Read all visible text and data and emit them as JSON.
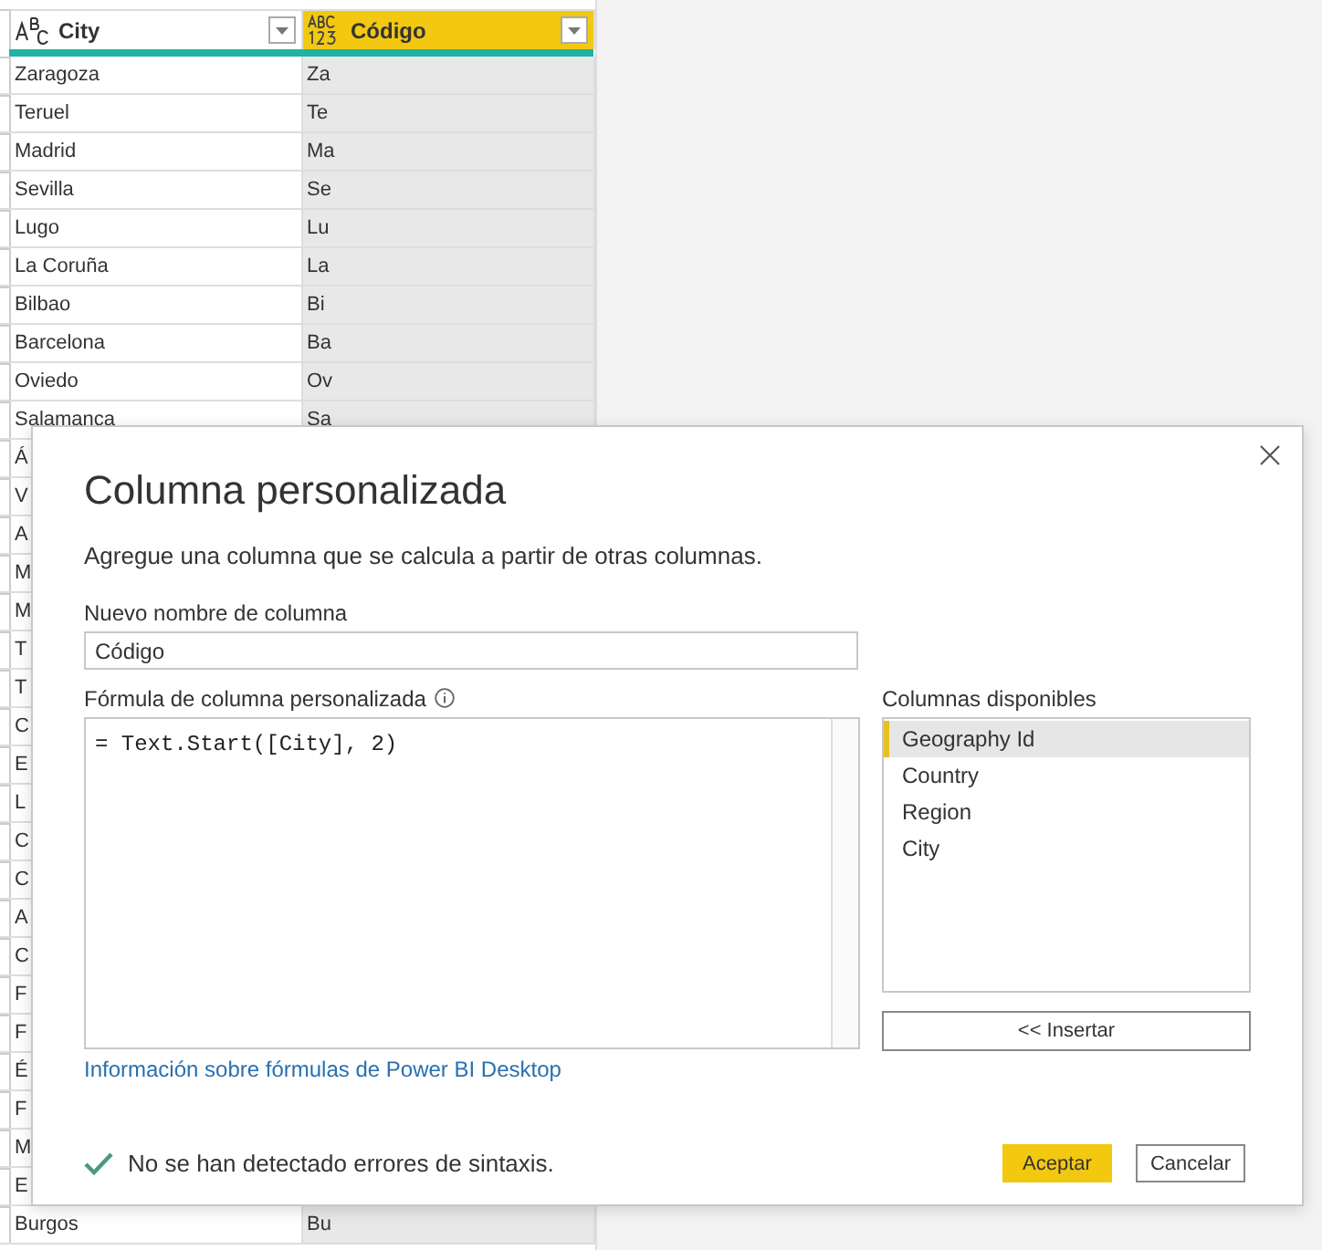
{
  "table": {
    "columns": [
      {
        "label": "City",
        "kind": "text",
        "selected": false
      },
      {
        "label": "Código",
        "kind": "any",
        "selected": true
      }
    ],
    "rows": [
      {
        "city": "Zaragoza",
        "code": "Za"
      },
      {
        "city": "Teruel",
        "code": "Te"
      },
      {
        "city": "Madrid",
        "code": "Ma"
      },
      {
        "city": "Sevilla",
        "code": "Se"
      },
      {
        "city": "Lugo",
        "code": "Lu"
      },
      {
        "city": "La Coruña",
        "code": "La"
      },
      {
        "city": "Bilbao",
        "code": "Bi"
      },
      {
        "city": "Barcelona",
        "code": "Ba"
      },
      {
        "city": "Oviedo",
        "code": "Ov"
      },
      {
        "city": "Salamanca",
        "code": "Sa"
      },
      {
        "city": "Á"
      },
      {
        "city": "V"
      },
      {
        "city": "A"
      },
      {
        "city": "M"
      },
      {
        "city": "M"
      },
      {
        "city": "T"
      },
      {
        "city": "T"
      },
      {
        "city": "C"
      },
      {
        "city": "E"
      },
      {
        "city": "L"
      },
      {
        "city": "C"
      },
      {
        "city": "C"
      },
      {
        "city": "A"
      },
      {
        "city": "C"
      },
      {
        "city": "F"
      },
      {
        "city": "F"
      },
      {
        "city": "É"
      },
      {
        "city": "F"
      },
      {
        "city": "M"
      },
      {
        "city": "E"
      },
      {
        "city": "Burgos",
        "code": "Bu"
      }
    ]
  },
  "dialog": {
    "title": "Columna personalizada",
    "description": "Agregue una columna que se calcula a partir de otras columnas.",
    "name_label": "Nuevo nombre de columna",
    "name_value": "Código",
    "formula_label": "Fórmula de columna personalizada",
    "formula": "= Text.Start([City], 2)",
    "columns_label": "Columnas disponibles",
    "columns": [
      {
        "label": "Geography Id",
        "selected": true
      },
      {
        "label": "Country",
        "selected": false
      },
      {
        "label": "Region",
        "selected": false
      },
      {
        "label": "City",
        "selected": false
      }
    ],
    "insert_button": "<< Insertar",
    "help_link": "Información sobre fórmulas de Power BI Desktop",
    "status": "No se han detectado errores de sintaxis.",
    "ok_button": "Aceptar",
    "cancel_button": "Cancelar"
  }
}
